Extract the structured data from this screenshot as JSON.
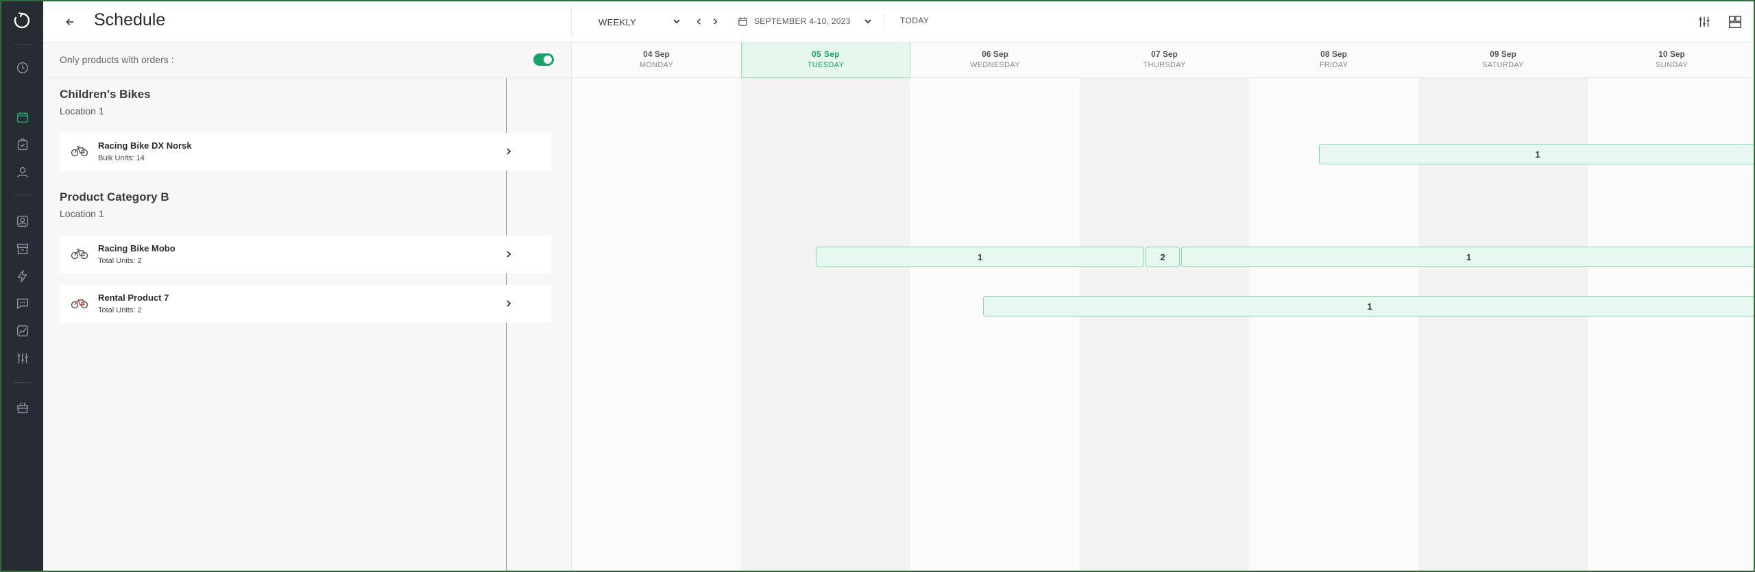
{
  "app": {
    "title": "Schedule",
    "accent": "#17a36b",
    "sidebar_bg": "#272b33"
  },
  "sidebar": {
    "icons": [
      "logo-icon",
      "history-icon",
      "calendar-icon",
      "orders-icon",
      "customer-icon",
      "contacts-icon",
      "inventory-icon",
      "automation-icon",
      "messages-icon",
      "reports-icon",
      "settings-sliders-icon",
      "store-icon"
    ]
  },
  "toolbar": {
    "view_mode": "WEEKLY",
    "date_range": "SEPTEMBER 4-10, 2023",
    "today_label": "TODAY"
  },
  "filter": {
    "label": "Only products with orders :",
    "enabled": true
  },
  "groups": [
    {
      "name": "Children's Bikes",
      "location": "Location 1",
      "products": [
        {
          "name": "Racing Bike DX Norsk",
          "units": "Bulk Units: 14",
          "icon": "bike-icon"
        }
      ]
    },
    {
      "name": "Product Category B",
      "location": "Location 1",
      "products": [
        {
          "name": "Racing Bike Mobo",
          "units": "Total Units: 2",
          "icon": "bike-icon"
        },
        {
          "name": "Rental Product 7",
          "units": "Total Units: 2",
          "icon": "bike-red-icon"
        }
      ]
    }
  ],
  "days": [
    {
      "date": "04 Sep",
      "weekday": "MONDAY"
    },
    {
      "date": "05 Sep",
      "weekday": "TUESDAY",
      "today": true
    },
    {
      "date": "06 Sep",
      "weekday": "WEDNESDAY"
    },
    {
      "date": "07 Sep",
      "weekday": "THURSDAY"
    },
    {
      "date": "08 Sep",
      "weekday": "FRIDAY"
    },
    {
      "date": "09 Sep",
      "weekday": "SATURDAY"
    },
    {
      "date": "10 Sep",
      "weekday": "SUNDAY"
    }
  ],
  "bookings": [
    {
      "row": "Racing Bike DX Norsk",
      "label": "1"
    },
    {
      "row": "Racing Bike Mobo",
      "label": "1"
    },
    {
      "row": "Racing Bike Mobo",
      "label": "2"
    },
    {
      "row": "Racing Bike Mobo",
      "label": "1"
    },
    {
      "row": "Rental Product 7",
      "label": "1"
    }
  ]
}
